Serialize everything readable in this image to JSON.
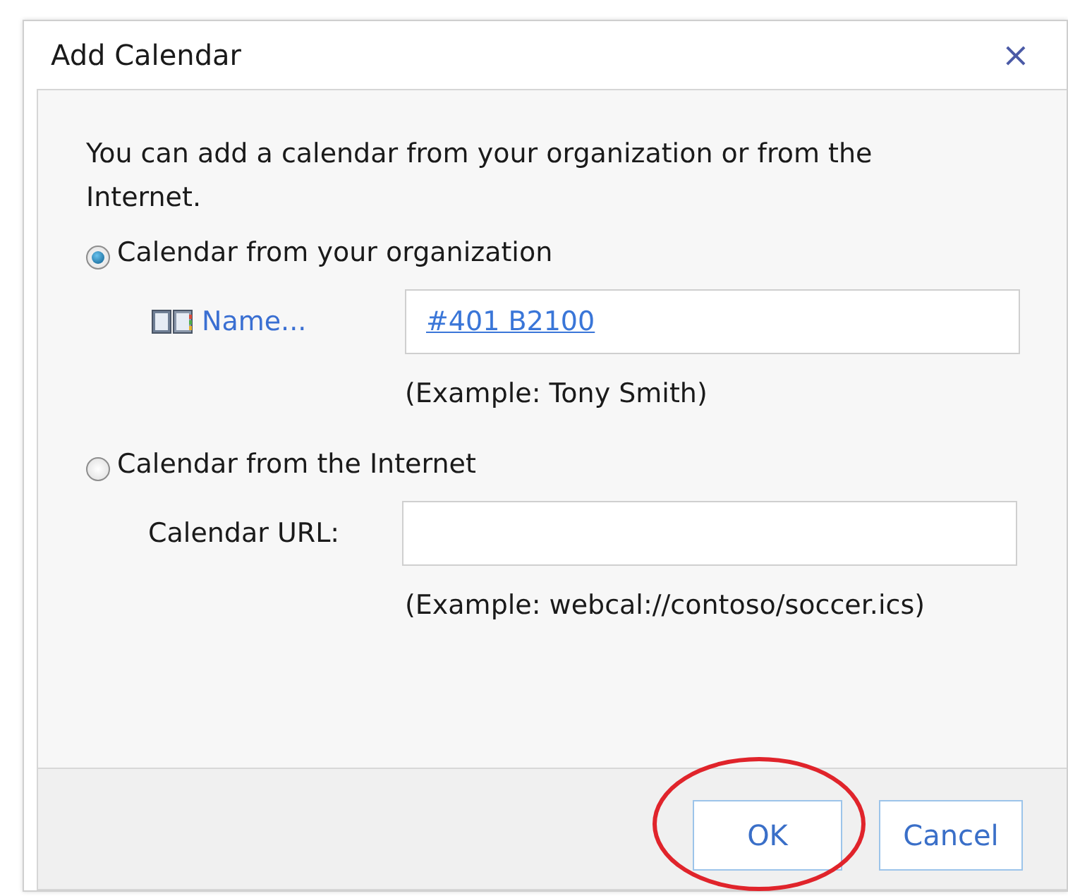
{
  "window": {
    "title": "Add Calendar",
    "close": "×"
  },
  "intro": "You can add a calendar from your organization or from the Internet.",
  "options": [
    {
      "kind": "name",
      "label": "Calendar from your organization",
      "selected": true,
      "field_label": "Name...",
      "value": "#401 B2100",
      "example": "(Example: Tony Smith)"
    },
    {
      "kind": "url",
      "label": "Calendar from the Internet",
      "selected": false,
      "field_label": "Calendar URL:",
      "example": "(Example: webcal://contoso/soccer.ics)"
    }
  ],
  "buttons": [
    {
      "label": "OK",
      "circled": true
    },
    {
      "label": "Cancel",
      "circled": false
    }
  ]
}
